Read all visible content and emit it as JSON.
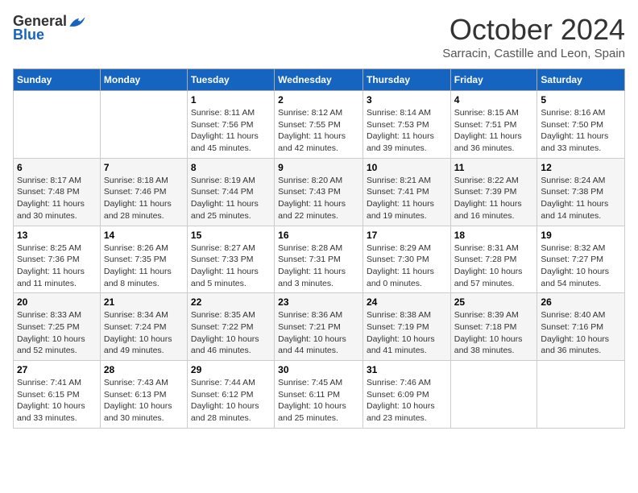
{
  "header": {
    "logo_general": "General",
    "logo_blue": "Blue",
    "month_title": "October 2024",
    "location": "Sarracin, Castille and Leon, Spain"
  },
  "weekdays": [
    "Sunday",
    "Monday",
    "Tuesday",
    "Wednesday",
    "Thursday",
    "Friday",
    "Saturday"
  ],
  "weeks": [
    [
      {
        "day": "",
        "info": ""
      },
      {
        "day": "",
        "info": ""
      },
      {
        "day": "1",
        "info": "Sunrise: 8:11 AM\nSunset: 7:56 PM\nDaylight: 11 hours and 45 minutes."
      },
      {
        "day": "2",
        "info": "Sunrise: 8:12 AM\nSunset: 7:55 PM\nDaylight: 11 hours and 42 minutes."
      },
      {
        "day": "3",
        "info": "Sunrise: 8:14 AM\nSunset: 7:53 PM\nDaylight: 11 hours and 39 minutes."
      },
      {
        "day": "4",
        "info": "Sunrise: 8:15 AM\nSunset: 7:51 PM\nDaylight: 11 hours and 36 minutes."
      },
      {
        "day": "5",
        "info": "Sunrise: 8:16 AM\nSunset: 7:50 PM\nDaylight: 11 hours and 33 minutes."
      }
    ],
    [
      {
        "day": "6",
        "info": "Sunrise: 8:17 AM\nSunset: 7:48 PM\nDaylight: 11 hours and 30 minutes."
      },
      {
        "day": "7",
        "info": "Sunrise: 8:18 AM\nSunset: 7:46 PM\nDaylight: 11 hours and 28 minutes."
      },
      {
        "day": "8",
        "info": "Sunrise: 8:19 AM\nSunset: 7:44 PM\nDaylight: 11 hours and 25 minutes."
      },
      {
        "day": "9",
        "info": "Sunrise: 8:20 AM\nSunset: 7:43 PM\nDaylight: 11 hours and 22 minutes."
      },
      {
        "day": "10",
        "info": "Sunrise: 8:21 AM\nSunset: 7:41 PM\nDaylight: 11 hours and 19 minutes."
      },
      {
        "day": "11",
        "info": "Sunrise: 8:22 AM\nSunset: 7:39 PM\nDaylight: 11 hours and 16 minutes."
      },
      {
        "day": "12",
        "info": "Sunrise: 8:24 AM\nSunset: 7:38 PM\nDaylight: 11 hours and 14 minutes."
      }
    ],
    [
      {
        "day": "13",
        "info": "Sunrise: 8:25 AM\nSunset: 7:36 PM\nDaylight: 11 hours and 11 minutes."
      },
      {
        "day": "14",
        "info": "Sunrise: 8:26 AM\nSunset: 7:35 PM\nDaylight: 11 hours and 8 minutes."
      },
      {
        "day": "15",
        "info": "Sunrise: 8:27 AM\nSunset: 7:33 PM\nDaylight: 11 hours and 5 minutes."
      },
      {
        "day": "16",
        "info": "Sunrise: 8:28 AM\nSunset: 7:31 PM\nDaylight: 11 hours and 3 minutes."
      },
      {
        "day": "17",
        "info": "Sunrise: 8:29 AM\nSunset: 7:30 PM\nDaylight: 11 hours and 0 minutes."
      },
      {
        "day": "18",
        "info": "Sunrise: 8:31 AM\nSunset: 7:28 PM\nDaylight: 10 hours and 57 minutes."
      },
      {
        "day": "19",
        "info": "Sunrise: 8:32 AM\nSunset: 7:27 PM\nDaylight: 10 hours and 54 minutes."
      }
    ],
    [
      {
        "day": "20",
        "info": "Sunrise: 8:33 AM\nSunset: 7:25 PM\nDaylight: 10 hours and 52 minutes."
      },
      {
        "day": "21",
        "info": "Sunrise: 8:34 AM\nSunset: 7:24 PM\nDaylight: 10 hours and 49 minutes."
      },
      {
        "day": "22",
        "info": "Sunrise: 8:35 AM\nSunset: 7:22 PM\nDaylight: 10 hours and 46 minutes."
      },
      {
        "day": "23",
        "info": "Sunrise: 8:36 AM\nSunset: 7:21 PM\nDaylight: 10 hours and 44 minutes."
      },
      {
        "day": "24",
        "info": "Sunrise: 8:38 AM\nSunset: 7:19 PM\nDaylight: 10 hours and 41 minutes."
      },
      {
        "day": "25",
        "info": "Sunrise: 8:39 AM\nSunset: 7:18 PM\nDaylight: 10 hours and 38 minutes."
      },
      {
        "day": "26",
        "info": "Sunrise: 8:40 AM\nSunset: 7:16 PM\nDaylight: 10 hours and 36 minutes."
      }
    ],
    [
      {
        "day": "27",
        "info": "Sunrise: 7:41 AM\nSunset: 6:15 PM\nDaylight: 10 hours and 33 minutes."
      },
      {
        "day": "28",
        "info": "Sunrise: 7:43 AM\nSunset: 6:13 PM\nDaylight: 10 hours and 30 minutes."
      },
      {
        "day": "29",
        "info": "Sunrise: 7:44 AM\nSunset: 6:12 PM\nDaylight: 10 hours and 28 minutes."
      },
      {
        "day": "30",
        "info": "Sunrise: 7:45 AM\nSunset: 6:11 PM\nDaylight: 10 hours and 25 minutes."
      },
      {
        "day": "31",
        "info": "Sunrise: 7:46 AM\nSunset: 6:09 PM\nDaylight: 10 hours and 23 minutes."
      },
      {
        "day": "",
        "info": ""
      },
      {
        "day": "",
        "info": ""
      }
    ]
  ]
}
